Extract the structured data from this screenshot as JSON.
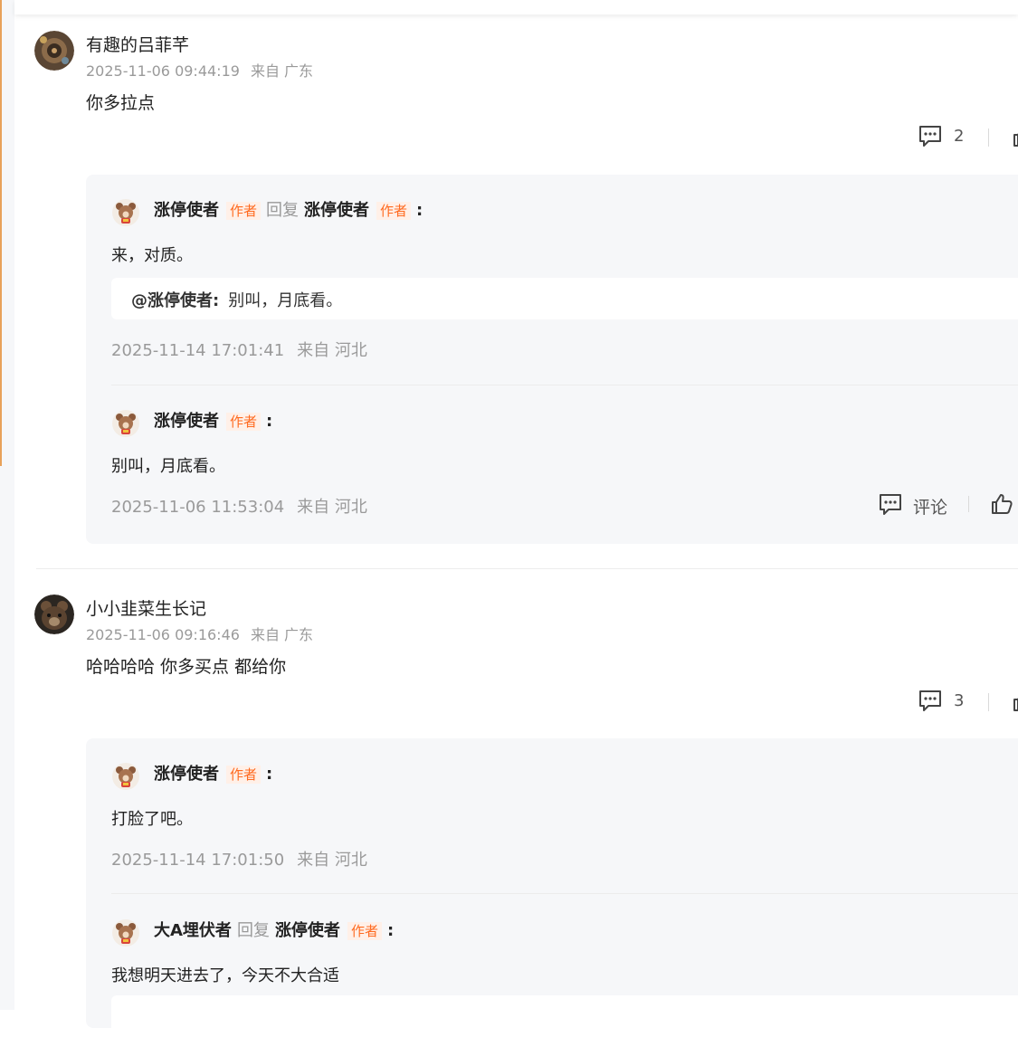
{
  "comments": [
    {
      "username": "有趣的吕菲芊",
      "time": "2025-11-06 09:44:19",
      "location": "来自 广东",
      "text": "你多拉点",
      "reply_count": "2",
      "replies": [
        {
          "name": "涨停使者",
          "tag": "作者",
          "reply_word": "回复",
          "target": "涨停使者",
          "target_tag": "作者",
          "colon": ":",
          "text": "来，对质。",
          "quote_name": "@涨停使者:",
          "quote_text": "别叫，月底看。",
          "time": "2025-11-14 17:01:41",
          "location": "来自 河北"
        },
        {
          "name": "涨停使者",
          "tag": "作者",
          "colon": ":",
          "text": "别叫，月底看。",
          "time": "2025-11-06 11:53:04",
          "location": "来自 河北",
          "comment_label": "评论"
        }
      ]
    },
    {
      "username": "小小韭菜生长记",
      "time": "2025-11-06 09:16:46",
      "location": "来自 广东",
      "text": "哈哈哈哈 你多买点 都给你",
      "reply_count": "3",
      "replies": [
        {
          "name": "涨停使者",
          "tag": "作者",
          "colon": ":",
          "text": "打脸了吧。",
          "time": "2025-11-14 17:01:50",
          "location": "来自 河北"
        },
        {
          "name": "大A埋伏者",
          "reply_word": "回复",
          "target": "涨停使者",
          "target_tag": "作者",
          "colon": ":",
          "text": "我想明天进去了，今天不大合适"
        }
      ]
    }
  ],
  "icons": {
    "comment": "comment-bubble-icon",
    "like": "thumbs-up-icon",
    "avatar_reply": "bear-avatar-icon"
  },
  "colors": {
    "author_tag": "#ff6a1f",
    "author_tag_bg": "#fff0e8",
    "reply_bg": "#f6f7f9",
    "meta": "#9a9a9a"
  }
}
